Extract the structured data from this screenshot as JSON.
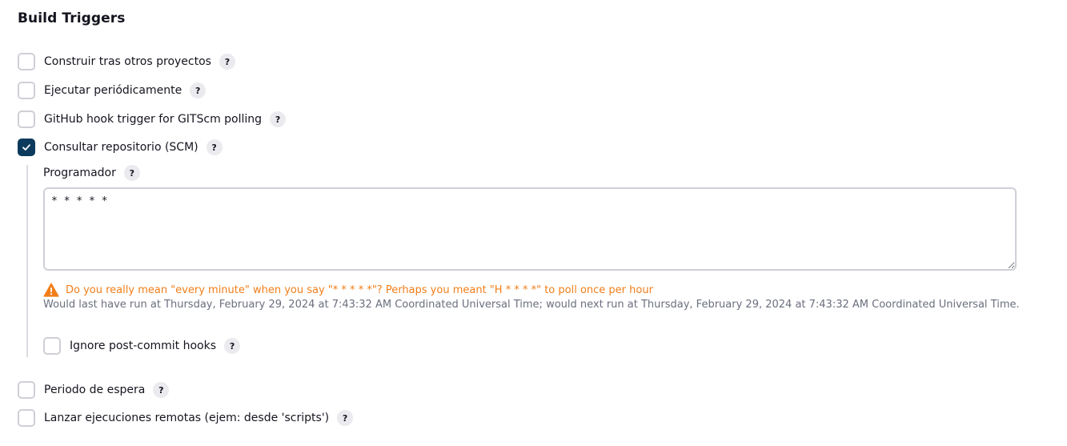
{
  "section": {
    "title": "Build Triggers"
  },
  "triggers": {
    "build_after_other_projects": {
      "label": "Construir tras otros proyectos",
      "checked": false
    },
    "build_periodically": {
      "label": "Ejecutar periódicamente",
      "checked": false
    },
    "github_hook": {
      "label": "GitHub hook trigger for GITScm polling",
      "checked": false
    },
    "poll_scm": {
      "label": "Consultar repositorio (SCM)",
      "checked": true
    },
    "quiet_period": {
      "label": "Periodo de espera",
      "checked": false
    },
    "remote_trigger": {
      "label": "Lanzar ejecuciones remotas (ejem: desde 'scripts')",
      "checked": false
    }
  },
  "poll_scm_config": {
    "schedule_label": "Programador",
    "schedule_value": "* * * * *",
    "warning": "Do you really mean \"every minute\" when you say \"* * * * *\"? Perhaps you meant \"H * * * *\" to poll once per hour",
    "info": "Would last have run at Thursday, February 29, 2024 at 7:43:32 AM Coordinated Universal Time; would next run at Thursday, February 29, 2024 at 7:43:32 AM Coordinated Universal Time.",
    "ignore_hooks": {
      "label": "Ignore post-commit hooks",
      "checked": false
    }
  },
  "help_symbol": "?",
  "colors": {
    "checked": "#0b3a5c",
    "warning": "#f27e19",
    "info_text": "#6b6f7e"
  },
  "icons": {
    "help": "question-mark-icon",
    "warning": "warning-triangle-icon",
    "check": "checkmark-icon"
  }
}
